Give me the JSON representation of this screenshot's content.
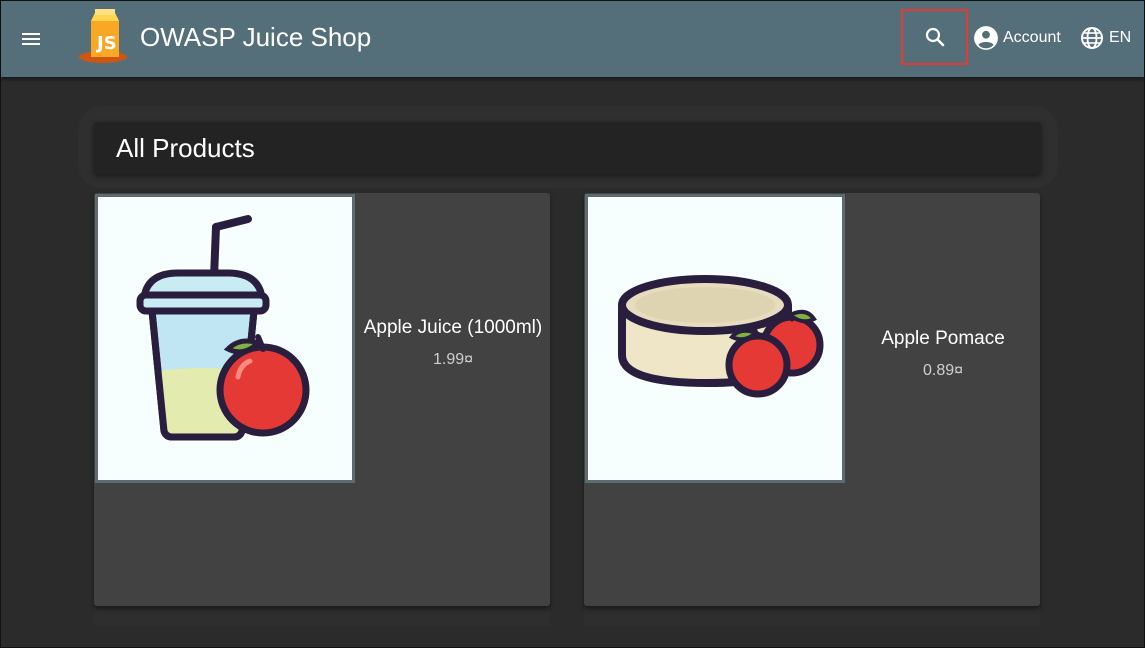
{
  "app": {
    "title": "OWASP Juice Shop"
  },
  "toolbar": {
    "menu_icon": "menu-icon",
    "search_icon": "search-icon",
    "account_label": "Account",
    "language_label": "EN"
  },
  "main": {
    "header_title": "All Products",
    "products": [
      {
        "name": "Apple Juice (1000ml)",
        "price": "1.99¤",
        "image": "apple-juice-image"
      },
      {
        "name": "Apple Pomace",
        "price": "0.89¤",
        "image": "apple-pomace-image"
      }
    ]
  },
  "colors": {
    "toolbar": "#546e7a",
    "background": "#303030",
    "card": "#424242",
    "highlight": "#e53935"
  }
}
